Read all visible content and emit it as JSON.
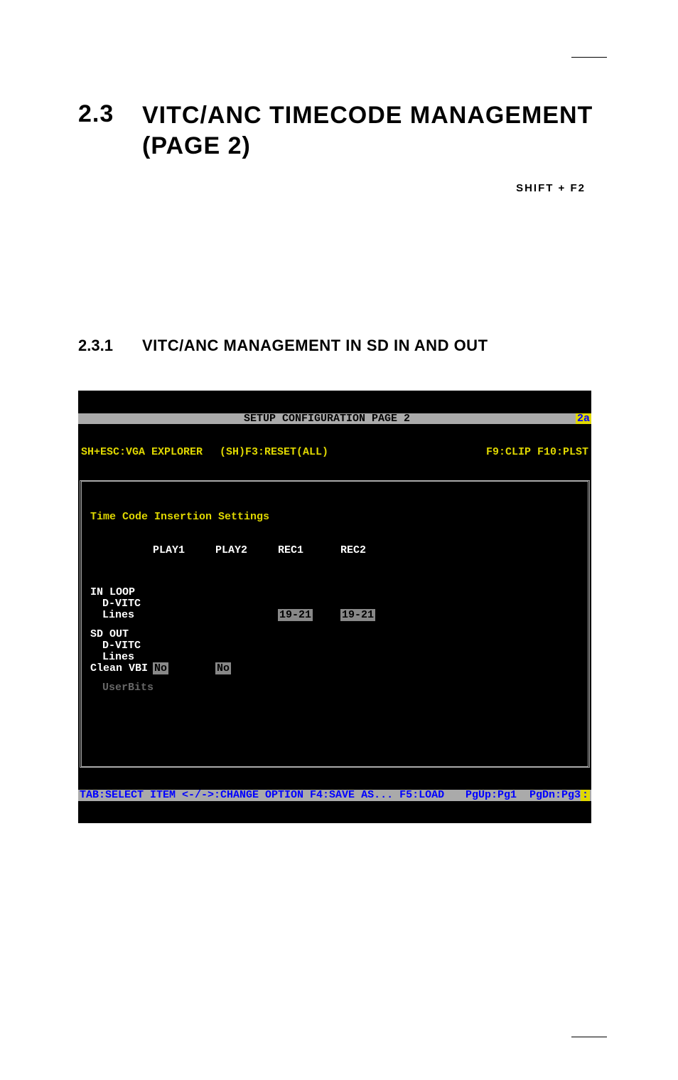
{
  "heading": {
    "number": "2.3",
    "title": "VITC/ANC TIMECODE MANAGEMENT (PAGE 2)",
    "shortcut": "SHIFT + F2"
  },
  "subheading": {
    "number": "2.3.1",
    "title": "VITC/ANC MANAGEMENT IN SD IN AND OUT"
  },
  "terminal": {
    "title": "SETUP CONFIGURATION PAGE 2",
    "title_corner": "2a",
    "fn_left": "SH+ESC:VGA EXPLORER",
    "fn_mid": "(SH)F3:RESET(ALL)",
    "fn_right": "F9:CLIP F10:PLST",
    "section_title": "Time Code Insertion Settings",
    "columns": [
      "PLAY1",
      "PLAY2",
      "REC1",
      "REC2"
    ],
    "groups": [
      {
        "name": "IN LOOP",
        "rows": [
          {
            "label": "D-VITC",
            "values": [
              "",
              "",
              "",
              ""
            ]
          },
          {
            "label": "Lines",
            "values": [
              "",
              "",
              "19-21",
              "19-21"
            ],
            "highlight": [
              false,
              false,
              true,
              true
            ]
          }
        ]
      },
      {
        "name": "SD OUT",
        "rows": [
          {
            "label": "D-VITC",
            "values": [
              "",
              "",
              "",
              ""
            ]
          },
          {
            "label": "Lines",
            "values": [
              "",
              "",
              "",
              ""
            ]
          },
          {
            "label": "Clean VBI",
            "values": [
              "No",
              "No",
              "",
              ""
            ],
            "highlight": [
              true,
              true,
              false,
              false
            ],
            "nolabelpad": true
          }
        ]
      },
      {
        "name": "",
        "rows": [
          {
            "label": "UserBits",
            "values": [
              "",
              "",
              "",
              ""
            ],
            "dim": true
          }
        ]
      }
    ],
    "footer_left": "TAB:SELECT ITEM <-/->:CHANGE OPTION F4:SAVE AS... F5:LOAD",
    "footer_right": "PgUp:Pg1  PgDn:Pg3",
    "footer_end": ":"
  }
}
